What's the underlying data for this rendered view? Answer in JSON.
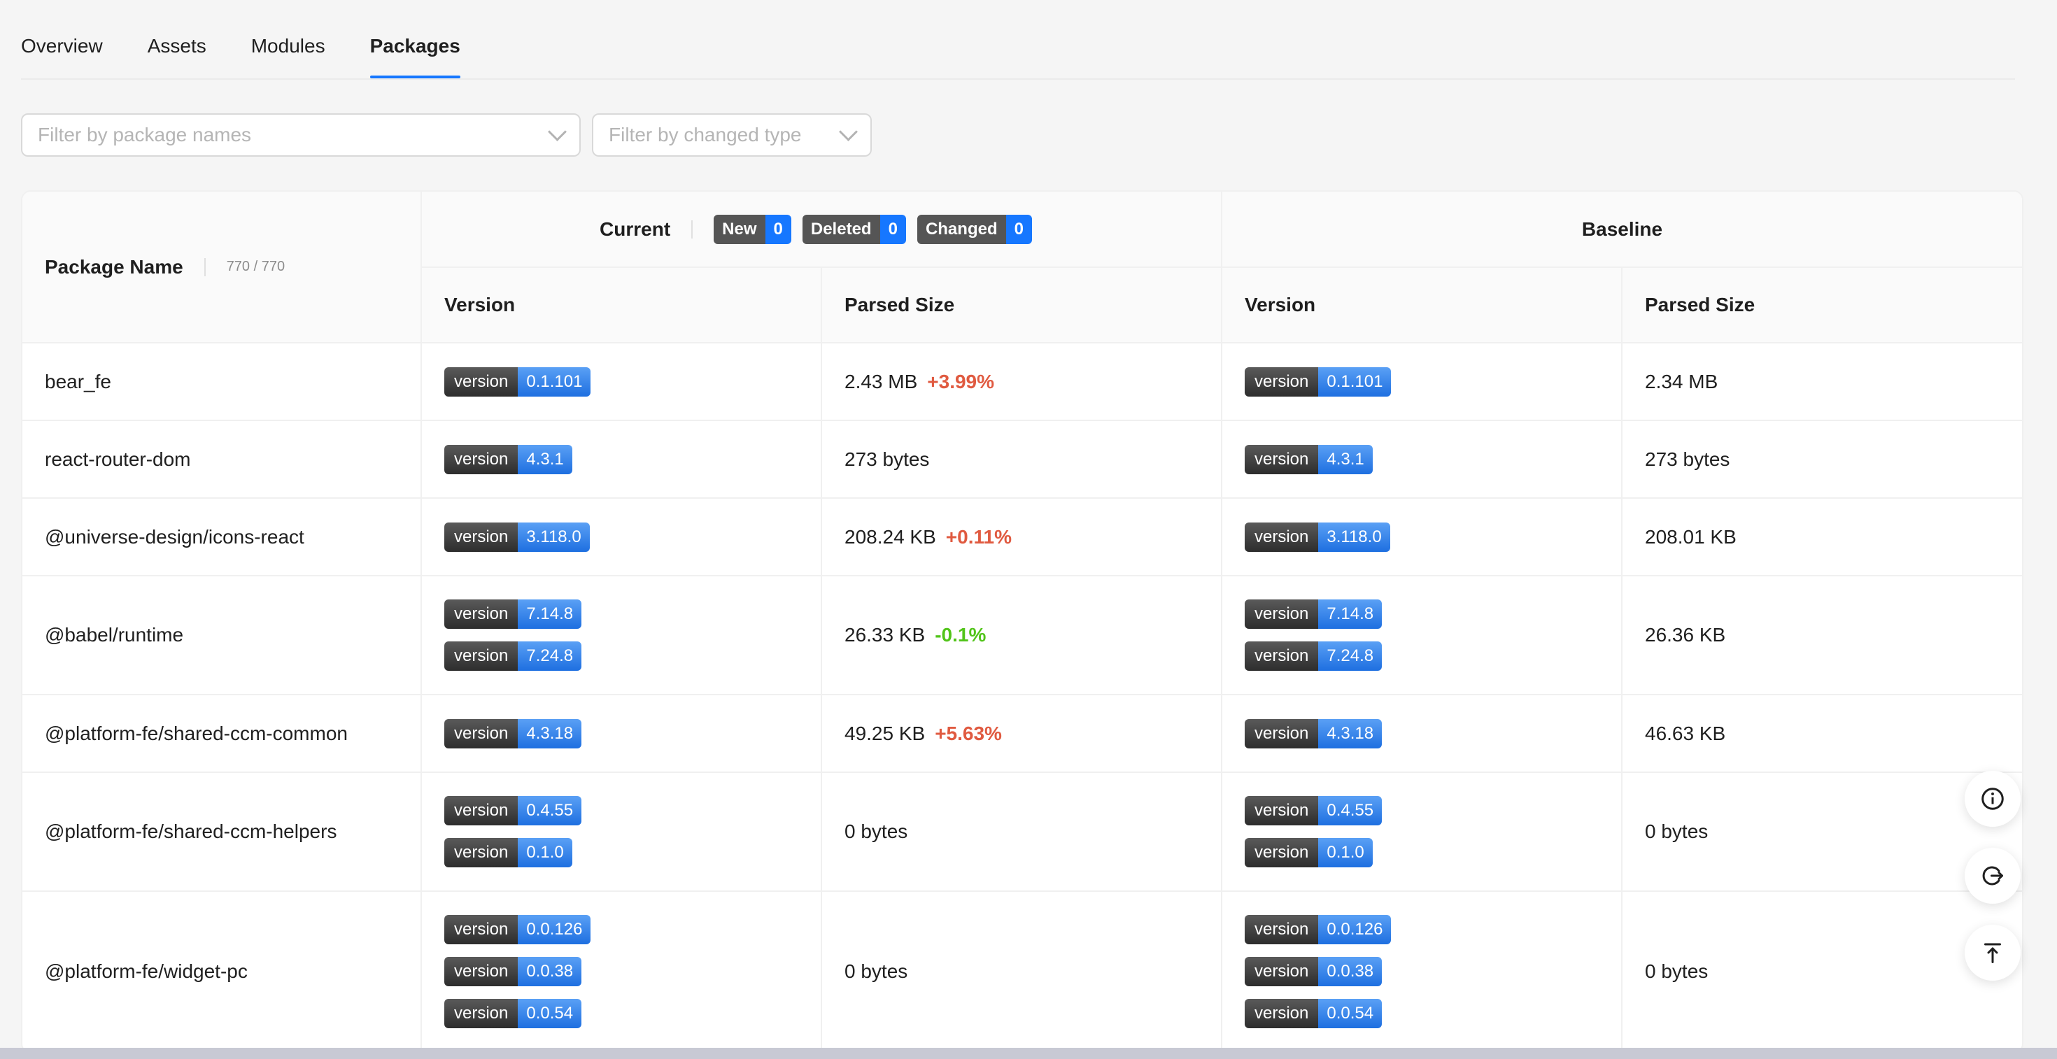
{
  "tabs": [
    {
      "label": "Overview"
    },
    {
      "label": "Assets"
    },
    {
      "label": "Modules"
    },
    {
      "label": "Packages"
    }
  ],
  "active_tab": "Packages",
  "filters": {
    "package_placeholder": "Filter by package names",
    "type_placeholder": "Filter by changed type"
  },
  "table": {
    "package_name_header": "Package Name",
    "package_count": "770 / 770",
    "current_header": "Current",
    "baseline_header": "Baseline",
    "stats": [
      {
        "label": "New",
        "value": "0"
      },
      {
        "label": "Deleted",
        "value": "0"
      },
      {
        "label": "Changed",
        "value": "0"
      }
    ],
    "version_header": "Version",
    "parsed_size_header": "Parsed Size",
    "badge_key": "version",
    "rows": [
      {
        "name": "bear_fe",
        "cur_versions": [
          "0.1.101"
        ],
        "cur_size": "2.43 MB",
        "change": "+3.99%",
        "change_dir": "up",
        "base_versions": [
          "0.1.101"
        ],
        "base_size": "2.34 MB"
      },
      {
        "name": "react-router-dom",
        "cur_versions": [
          "4.3.1"
        ],
        "cur_size": "273 bytes",
        "change": "",
        "change_dir": "",
        "base_versions": [
          "4.3.1"
        ],
        "base_size": "273 bytes"
      },
      {
        "name": "@universe-design/icons-react",
        "cur_versions": [
          "3.118.0"
        ],
        "cur_size": "208.24 KB",
        "change": "+0.11%",
        "change_dir": "up",
        "base_versions": [
          "3.118.0"
        ],
        "base_size": "208.01 KB"
      },
      {
        "name": "@babel/runtime",
        "cur_versions": [
          "7.14.8",
          "7.24.8"
        ],
        "cur_size": "26.33 KB",
        "change": "-0.1%",
        "change_dir": "down",
        "base_versions": [
          "7.14.8",
          "7.24.8"
        ],
        "base_size": "26.36 KB"
      },
      {
        "name": "@platform-fe/shared-ccm-common",
        "cur_versions": [
          "4.3.18"
        ],
        "cur_size": "49.25 KB",
        "change": "+5.63%",
        "change_dir": "up",
        "base_versions": [
          "4.3.18"
        ],
        "base_size": "46.63 KB"
      },
      {
        "name": "@platform-fe/shared-ccm-helpers",
        "cur_versions": [
          "0.4.55",
          "0.1.0"
        ],
        "cur_size": "0 bytes",
        "change": "",
        "change_dir": "",
        "base_versions": [
          "0.4.55",
          "0.1.0"
        ],
        "base_size": "0 bytes"
      },
      {
        "name": "@platform-fe/widget-pc",
        "cur_versions": [
          "0.0.126",
          "0.0.38",
          "0.0.54"
        ],
        "cur_size": "0 bytes",
        "change": "",
        "change_dir": "",
        "base_versions": [
          "0.0.126",
          "0.0.38",
          "0.0.54"
        ],
        "base_size": "0 bytes"
      }
    ]
  },
  "fabs": [
    {
      "icon": "info-icon"
    },
    {
      "icon": "logout-icon"
    },
    {
      "icon": "back-to-top-icon"
    }
  ]
}
